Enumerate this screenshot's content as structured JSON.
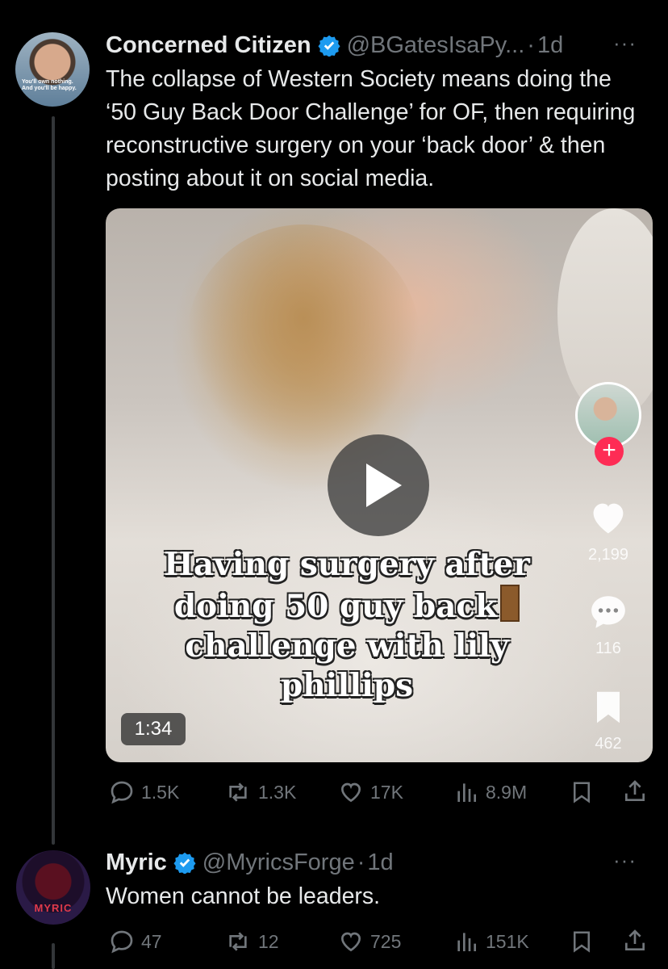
{
  "tweet1": {
    "display_name": "Concerned Citizen",
    "handle": "@BGatesIsaPy...",
    "separator": "·",
    "time": "1d",
    "more": "···",
    "avatar_lines": [
      "You'll own nothing.",
      "And you'll be happy."
    ],
    "text": "The collapse of Western Society means doing the ‘50 Guy Back Door Challenge’ for OF, then requiring reconstructive surgery on your ‘back door’ & then posting about it on social media.",
    "video": {
      "caption_lines": [
        "Having surgery after",
        "doing 50 guy back",
        "challenge with lily",
        "phillips"
      ],
      "duration": "1:34",
      "likes": "2,199",
      "comments": "116",
      "saves": "462"
    },
    "actions": {
      "replies": "1.5K",
      "reposts": "1.3K",
      "likes": "17K",
      "views": "8.9M"
    }
  },
  "tweet2": {
    "display_name": "Myric",
    "handle": "@MyricsForge",
    "separator": "·",
    "time": "1d",
    "more": "···",
    "avatar_label": "MYRIC",
    "text": "Women cannot be leaders.",
    "actions": {
      "replies": "47",
      "reposts": "12",
      "likes": "725",
      "views": "151K"
    }
  },
  "colors": {
    "background": "#000000",
    "text": "#e7e9ea",
    "muted": "#71767b",
    "verified": "#1d9bf0"
  }
}
